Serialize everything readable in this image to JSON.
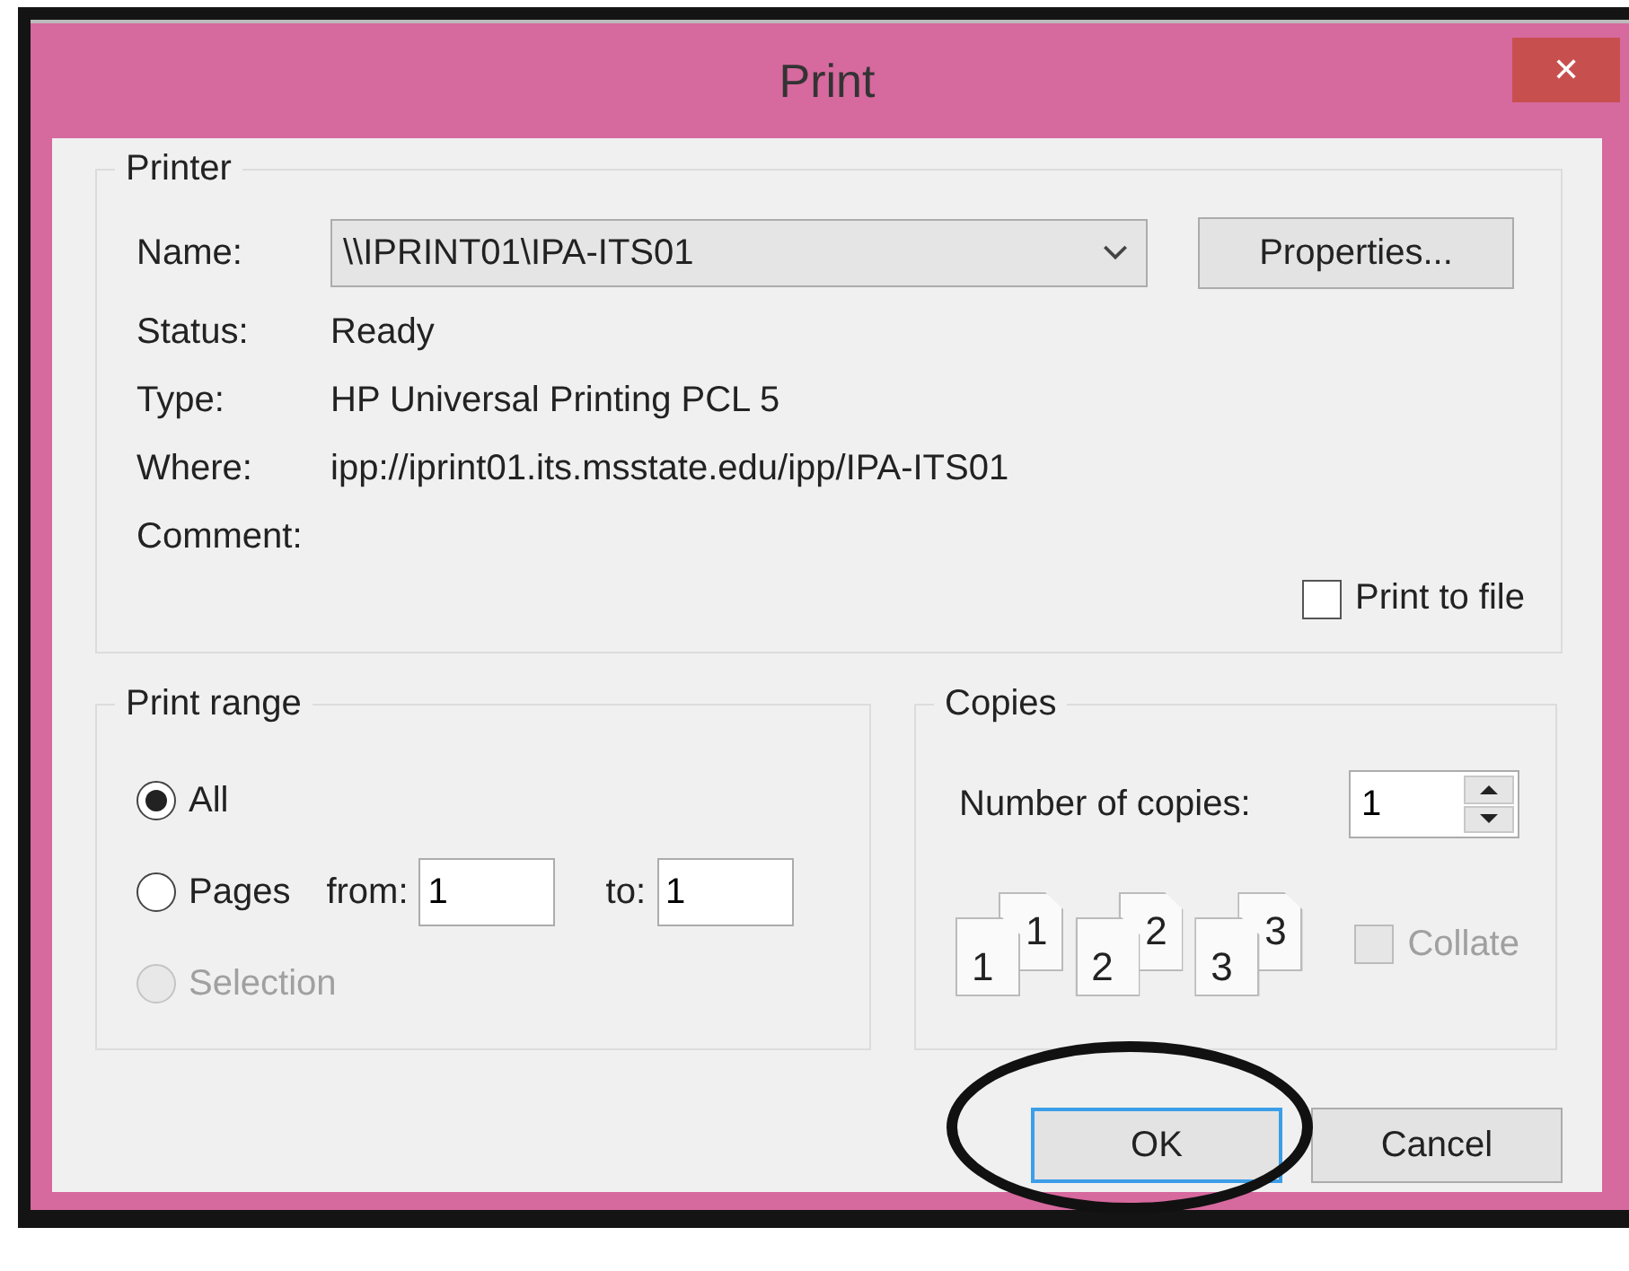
{
  "window": {
    "title": "Print",
    "close": "✕"
  },
  "printer": {
    "legend": "Printer",
    "name_label": "Name:",
    "name_value": "\\\\IPRINT01\\IPA-ITS01",
    "properties_button": "Properties...",
    "info": [
      {
        "label": "Status:",
        "value": "Ready"
      },
      {
        "label": "Type:",
        "value": "HP Universal Printing PCL 5"
      },
      {
        "label": "Where:",
        "value": "ipp://iprint01.its.msstate.edu/ipp/IPA-ITS01"
      },
      {
        "label": "Comment:"
      }
    ],
    "print_to_file": {
      "label": "Print to file",
      "checked": false
    }
  },
  "print_range": {
    "legend": "Print range",
    "options": [
      {
        "label": "All",
        "selected": true,
        "disabled": false
      },
      {
        "label": "Pages",
        "selected": false,
        "disabled": false
      },
      {
        "label": "Selection",
        "selected": false,
        "disabled": true
      }
    ],
    "from_label": "from:",
    "from_value": "1",
    "to_label": "to:",
    "to_value": "1"
  },
  "copies": {
    "legend": "Copies",
    "count_label": "Number of copies:",
    "count_value": "1",
    "collate_icons": [
      {
        "back": "1",
        "front": "1"
      },
      {
        "back": "2",
        "front": "2"
      },
      {
        "back": "3",
        "front": "3"
      }
    ],
    "collate": {
      "label": "Collate",
      "checked": false,
      "disabled": true
    }
  },
  "buttons": [
    {
      "label": "OK",
      "focused": true
    },
    {
      "label": "Cancel",
      "focused": false
    }
  ],
  "annotation": {
    "kind": "ellipse"
  }
}
